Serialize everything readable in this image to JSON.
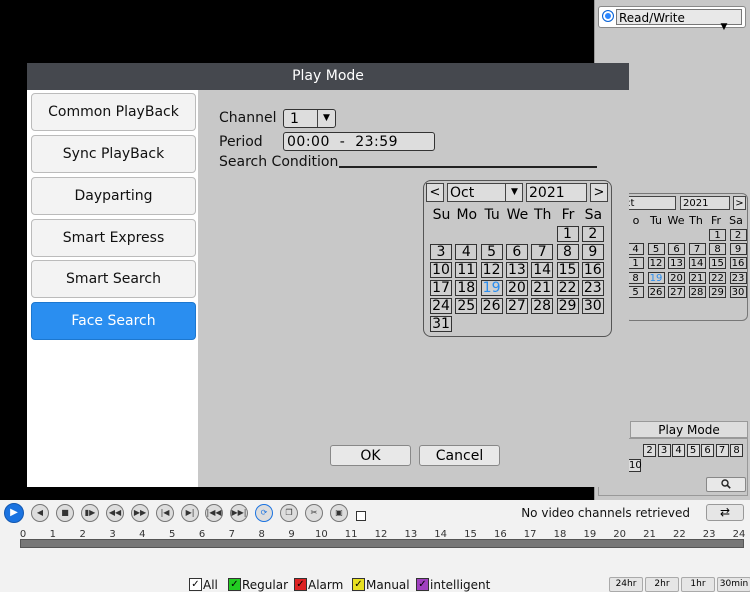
{
  "background_panel": {
    "access_mode": "Read/Write",
    "mini_calendar": {
      "month": "ct",
      "year": "2021",
      "next": ">",
      "weekday_headers": [
        "o",
        "Tu",
        "We",
        "Th",
        "Fr",
        "Sa"
      ],
      "rows": [
        [
          "",
          "",
          "",
          "",
          "1",
          "2"
        ],
        [
          "4",
          "5",
          "6",
          "7",
          "8",
          "9"
        ],
        [
          "1",
          "12",
          "13",
          "14",
          "15",
          "16"
        ],
        [
          "8",
          "19",
          "20",
          "21",
          "22",
          "23"
        ],
        [
          "5",
          "26",
          "27",
          "28",
          "29",
          "30"
        ]
      ]
    },
    "play_mode_label": "Play Mode",
    "channel_numbers": [
      "2",
      "3",
      "4",
      "5",
      "6",
      "7",
      "8"
    ],
    "channel_number_10": "10",
    "search_icon": "search-icon"
  },
  "dialog": {
    "title": "Play Mode",
    "modes": [
      "Common PlayBack",
      "Sync PlayBack",
      "Dayparting",
      "Smart Express",
      "Smart Search",
      "Face Search"
    ],
    "active_mode": "Face Search",
    "channel_label": "Channel",
    "channel_value": "1",
    "period_label": "Period",
    "period_value": "00:00  -  23:59",
    "search_condition_label": "Search Condition",
    "calendar": {
      "prev": "<",
      "next": ">",
      "month": "Oct",
      "year": "2021",
      "weekday_headers": [
        "Su",
        "Mo",
        "Tu",
        "We",
        "Th",
        "Fr",
        "Sa"
      ],
      "rows": [
        [
          "",
          "",
          "",
          "",
          "",
          "1",
          "2"
        ],
        [
          "3",
          "4",
          "5",
          "6",
          "7",
          "8",
          "9"
        ],
        [
          "10",
          "11",
          "12",
          "13",
          "14",
          "15",
          "16"
        ],
        [
          "17",
          "18",
          "19",
          "20",
          "21",
          "22",
          "23"
        ],
        [
          "24",
          "25",
          "26",
          "27",
          "28",
          "29",
          "30"
        ],
        [
          "31",
          "",
          "",
          "",
          "",
          "",
          ""
        ]
      ],
      "today": "19",
      "accent_color": "#2a8ef0"
    },
    "ok_label": "OK",
    "cancel_label": "Cancel"
  },
  "playback": {
    "status": "No video channels retrieved",
    "timeline_ticks": [
      "0",
      "1",
      "2",
      "3",
      "4",
      "5",
      "6",
      "7",
      "8",
      "9",
      "10",
      "11",
      "12",
      "13",
      "14",
      "15",
      "16",
      "17",
      "18",
      "19",
      "20",
      "21",
      "22",
      "23",
      "24"
    ],
    "legend": [
      {
        "label": "All",
        "color": "#ffffff"
      },
      {
        "label": "Regular",
        "color": "#22cc22"
      },
      {
        "label": "Alarm",
        "color": "#dd2222"
      },
      {
        "label": "Manual",
        "color": "#e8e020"
      },
      {
        "label": "intelligent",
        "color": "#a040c0"
      }
    ],
    "zoom": [
      "24hr",
      "2hr",
      "1hr",
      "30min"
    ]
  }
}
